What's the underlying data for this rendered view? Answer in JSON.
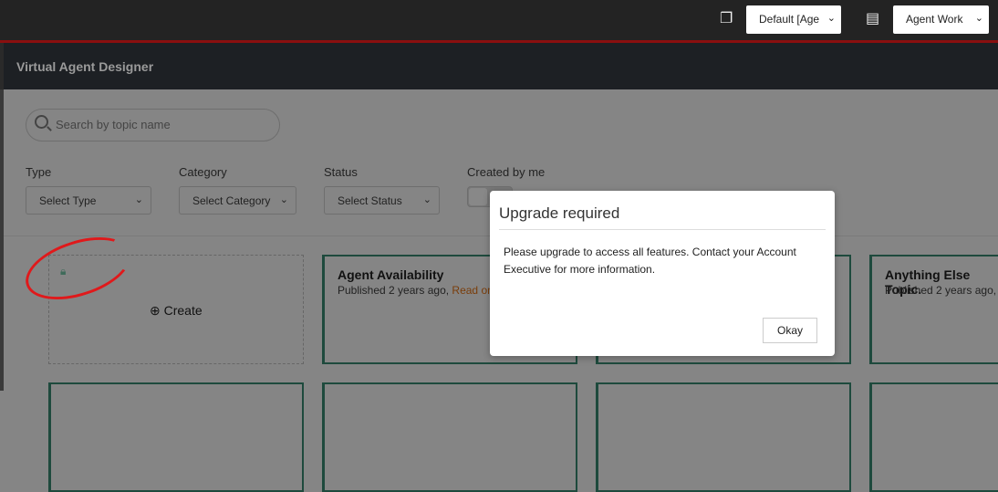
{
  "topbar": {
    "update_set": "Default [Age",
    "app_scope": "Agent Work"
  },
  "header": {
    "title": "Virtual Agent Designer"
  },
  "search": {
    "placeholder": "Search by topic name"
  },
  "filters": {
    "type_label": "Type",
    "type_value": "Select Type",
    "category_label": "Category",
    "category_value": "Select Category",
    "status_label": "Status",
    "status_value": "Select Status",
    "created_label": "Created by me"
  },
  "create_label": "Create",
  "cards": [
    {
      "title": "Agent Availability",
      "status": "Published 2 years ago, ",
      "extra": "Read on"
    },
    {
      "title": "Anything Else Topic.",
      "status": "Published 2 years ago,"
    }
  ],
  "modal": {
    "title": "Upgrade required",
    "body": "Please upgrade to access all features. Contact your Account Executive for more information.",
    "ok": "Okay"
  }
}
